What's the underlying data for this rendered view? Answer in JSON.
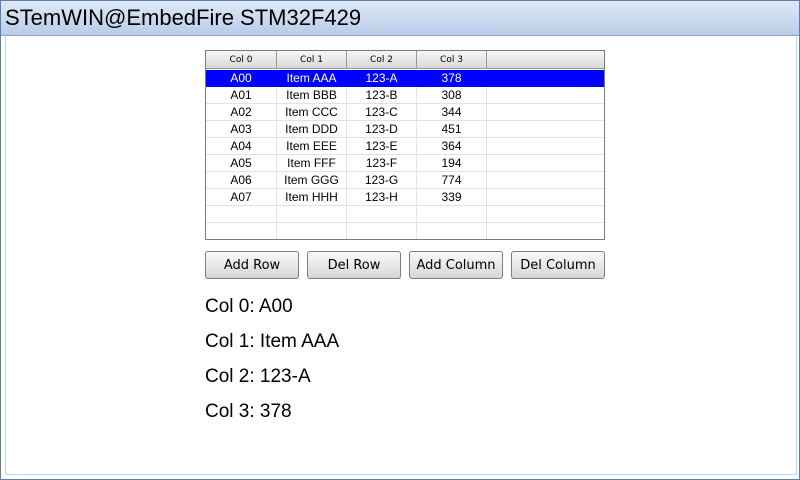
{
  "window": {
    "title": "STemWIN@EmbedFire STM32F429"
  },
  "listview": {
    "headers": [
      "Col 0",
      "Col 1",
      "Col 2",
      "Col 3",
      ""
    ],
    "rows": [
      [
        "A00",
        "Item AAA",
        "123-A",
        "378",
        ""
      ],
      [
        "A01",
        "Item BBB",
        "123-B",
        "308",
        ""
      ],
      [
        "A02",
        "Item CCC",
        "123-C",
        "344",
        ""
      ],
      [
        "A03",
        "Item DDD",
        "123-D",
        "451",
        ""
      ],
      [
        "A04",
        "Item EEE",
        "123-E",
        "364",
        ""
      ],
      [
        "A05",
        "Item FFF",
        "123-F",
        "194",
        ""
      ],
      [
        "A06",
        "Item GGG",
        "123-G",
        "774",
        ""
      ],
      [
        "A07",
        "Item HHH",
        "123-H",
        "339",
        ""
      ],
      [
        "",
        "",
        "",
        "",
        ""
      ],
      [
        "",
        "",
        "",
        "",
        ""
      ]
    ],
    "selected_row": 0,
    "selection_color": "#0000ff"
  },
  "buttons": {
    "add_row": "Add Row",
    "del_row": "Del Row",
    "add_column": "Add Column",
    "del_column": "Del Column"
  },
  "info": {
    "col0": "Col 0: A00",
    "col1": "Col 1: Item AAA",
    "col2": "Col 2: 123-A",
    "col3": "Col 3: 378"
  }
}
